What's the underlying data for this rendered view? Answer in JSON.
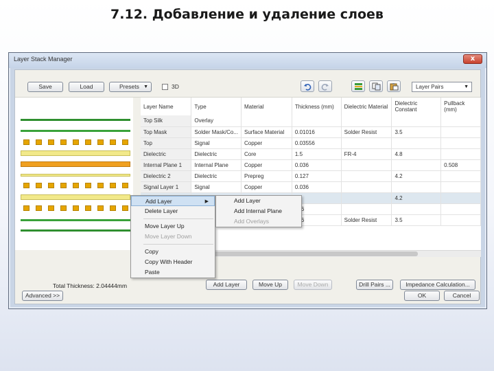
{
  "slide": {
    "title": "7.12. Добавление и удаление слоев"
  },
  "window": {
    "title": "Layer Stack Manager",
    "close_label": "x"
  },
  "toolbar": {
    "save_label": "Save",
    "load_label": "Load",
    "presets_label": "Presets",
    "checkbox_3d_label": "3D",
    "layer_pairs_select": "Layer Pairs"
  },
  "table": {
    "headers": [
      "Layer Name",
      "Type",
      "Material",
      "Thickness (mm)",
      "Dielectric Material",
      "Dielectric Constant",
      "Pullback (mm)"
    ],
    "rows": [
      [
        "Top Silk",
        "Overlay",
        "",
        "",
        "",
        "",
        ""
      ],
      [
        "Top Mask",
        "Solder Mask/Co...",
        "Surface Material",
        "0.01016",
        "Solder Resist",
        "3.5",
        ""
      ],
      [
        "Top",
        "Signal",
        "Copper",
        "0.03556",
        "",
        "",
        ""
      ],
      [
        "Dielectric",
        "Dielectric",
        "Core",
        "1.5",
        "FR-4",
        "4.8",
        ""
      ],
      [
        "Internal Plane 1",
        "Internal Plane",
        "Copper",
        "0.036",
        "",
        "",
        "0.508"
      ],
      [
        "Dielectric 2",
        "Dielectric",
        "Prepreg",
        "0.127",
        "",
        "4.2",
        ""
      ],
      [
        "Signal Layer 1",
        "Signal",
        "Copper",
        "0.036",
        "",
        "",
        ""
      ],
      [
        "",
        "",
        "",
        "4",
        "",
        "4.2",
        ""
      ],
      [
        "",
        "",
        "",
        "556",
        "",
        "",
        ""
      ],
      [
        "",
        "",
        "",
        "016",
        "Solder Resist",
        "3.5",
        ""
      ]
    ]
  },
  "bottom": {
    "total_thickness": "Total Thickness: 2.04444mm",
    "add_layer_label": "Add Layer",
    "move_up_label": "Move Up",
    "move_down_label": "Move Down",
    "drill_pairs_label": "Drill Pairs ...",
    "impedance_label": "Impedance Calculation...",
    "advanced_label": "Advanced >>",
    "ok_label": "OK",
    "cancel_label": "Cancel"
  },
  "context_menu": {
    "items": [
      "Add Layer",
      "Delete Layer",
      "Move Layer Up",
      "Move Layer Down",
      "Copy",
      "Copy With Header",
      "Paste"
    ]
  },
  "submenu": {
    "items": [
      "Add Layer",
      "Add Internal Plane",
      "Add Overlays"
    ]
  },
  "colors": {
    "copper": "#e6a500",
    "dielectric": "#f2e98a",
    "plane": "#f0a020",
    "overlay": "#2f8f2f",
    "mask": "#3aa23a",
    "selection": "#cfe1f3"
  }
}
